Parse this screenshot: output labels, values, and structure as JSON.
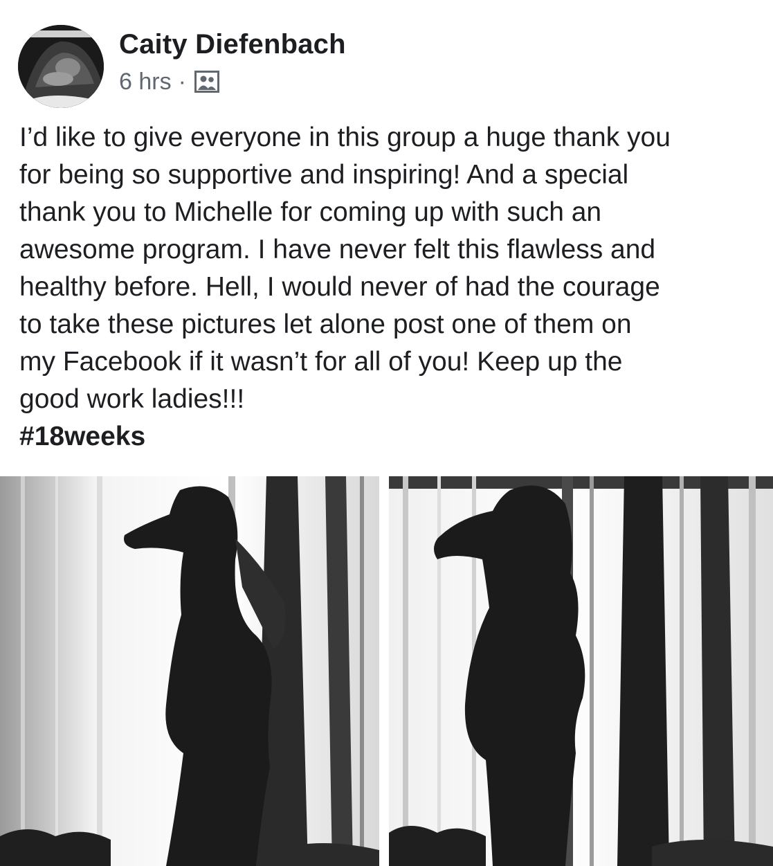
{
  "post": {
    "author": "Caity Diefenbach",
    "timestamp": "6 hrs",
    "separator": "·",
    "audience_icon": "group-icon",
    "body": "I’d like to give everyone in this group a huge thank you\nfor being so supportive and inspiring! And a special\nthank you to Michelle for coming up with such an\nawesome program. I have never felt this flawless and\nhealthy before. Hell, I would never of had the courage\nto take these pictures let alone post one of them on\nmy Facebook if it wasn’t for all of you! Keep up the\ngood work ladies!!!",
    "hashtag": "#18weeks"
  },
  "colors": {
    "text": "#1c1e21",
    "meta": "#606770",
    "background": "#ffffff"
  }
}
